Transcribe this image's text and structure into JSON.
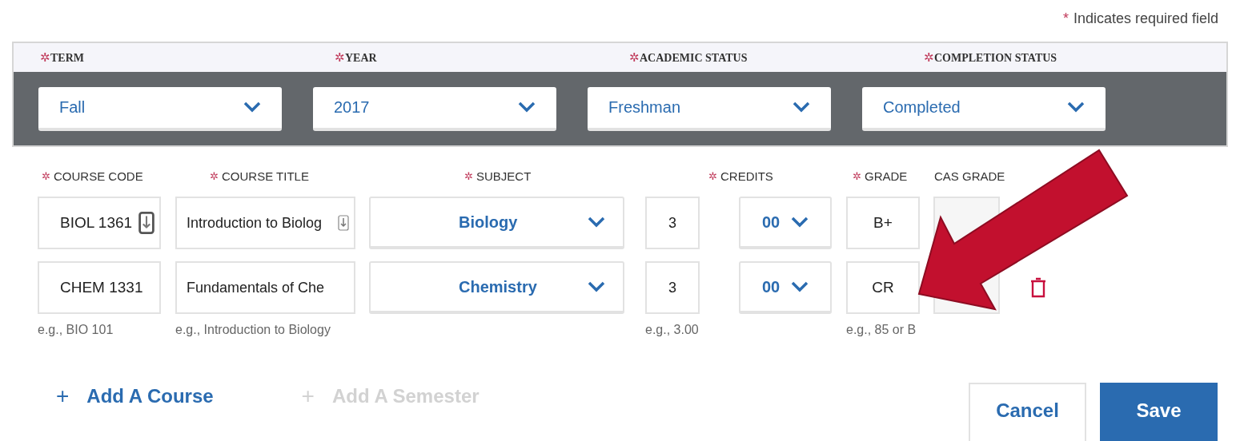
{
  "required_note": {
    "mark": "*",
    "text": "Indicates required field"
  },
  "required_glyph": "✲",
  "semester": {
    "fields": [
      {
        "label": "TERM",
        "required": true,
        "value": "Fall"
      },
      {
        "label": "YEAR",
        "required": true,
        "value": "2017"
      },
      {
        "label": "ACADEMIC STATUS",
        "required": true,
        "value": "Freshman"
      },
      {
        "label": "COMPLETION STATUS",
        "required": true,
        "value": "Completed"
      }
    ]
  },
  "course_columns": [
    {
      "label": "COURSE CODE",
      "required": true
    },
    {
      "label": "COURSE TITLE",
      "required": true
    },
    {
      "label": "SUBJECT",
      "required": true
    },
    {
      "label": "CREDITS",
      "required": true
    },
    {
      "label": "GRADE",
      "required": true
    },
    {
      "label": "CAS GRADE",
      "required": false
    }
  ],
  "courses": [
    {
      "code": "BIOL 1361",
      "title": "Introduction to Biolog",
      "show_icon": true,
      "subject": "Biology",
      "credits": "3",
      "credit_decimal": "00",
      "grade": "B+",
      "deletable": false
    },
    {
      "code": "CHEM 1331",
      "title": "Fundamentals of Che",
      "show_icon": false,
      "subject": "Chemistry",
      "credits": "3",
      "credit_decimal": "00",
      "grade": "CR",
      "deletable": true
    }
  ],
  "hints": {
    "code": "e.g., BIO 101",
    "title": "e.g., Introduction to Biology",
    "credits": "e.g., 3.00",
    "grade": "e.g., 85 or B"
  },
  "links": [
    {
      "icon": "+",
      "label": "Add A Course",
      "disabled": false
    },
    {
      "icon": "+",
      "label": "Add A Semester",
      "disabled": true
    }
  ],
  "buttons": [
    {
      "label": "Cancel",
      "kind": "secondary"
    },
    {
      "label": "Save",
      "kind": "primary"
    }
  ]
}
